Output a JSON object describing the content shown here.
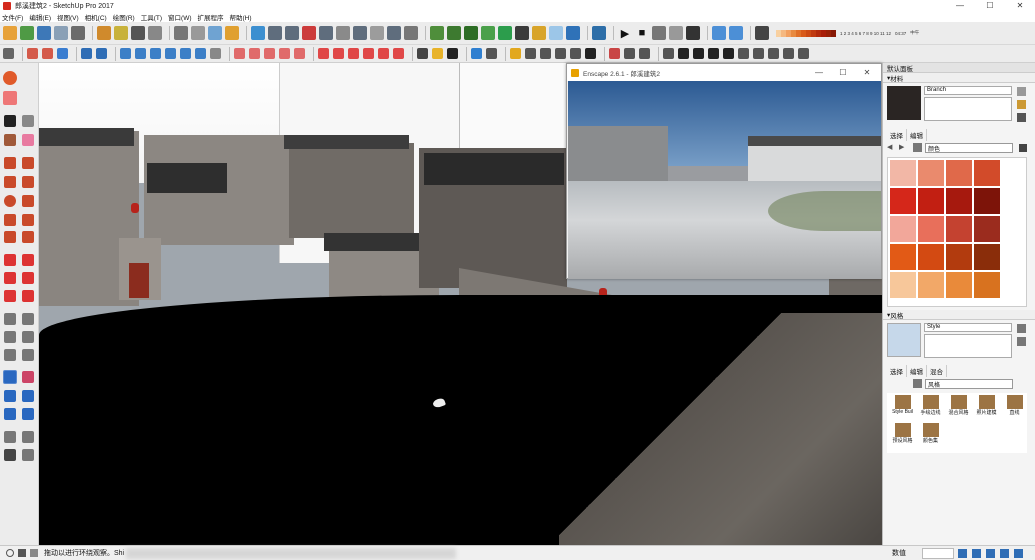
{
  "window": {
    "title": "郎溪建筑2 - SketchUp Pro 2017",
    "min": "—",
    "max": "☐",
    "close": "✕"
  },
  "menu": [
    "文件(F)",
    "编辑(E)",
    "视图(V)",
    "相机(C)",
    "绘图(R)",
    "工具(T)",
    "窗口(W)",
    "扩展程序",
    "帮助(H)"
  ],
  "toolbar": {
    "palette_numbers": "1 2 3 4 5 6 7 8 9 10 11 12",
    "time": "04:37",
    "time_label": "中午"
  },
  "enscape": {
    "title": "Enscape 2.6.1 - 郎溪建筑2",
    "min": "—",
    "max": "☐",
    "close": "✕"
  },
  "default_panel": {
    "title": "默认面板",
    "materials": {
      "section": "材料",
      "name": "Branch",
      "tabs": [
        "选择",
        "编辑"
      ],
      "library": "颜色",
      "swatches": [
        "#f2b7a6",
        "#ea8a6d",
        "#e0694a",
        "#d24b2a",
        "#d5271a",
        "#c21f12",
        "#a6190e",
        "#7d1409",
        "#f2a79a",
        "#e86f5b",
        "#c44230",
        "#9b2c1e",
        "#e25a16",
        "#d34a12",
        "#b23b0e",
        "#8a2d0a",
        "#f7c79a",
        "#f2a868",
        "#e98a3a",
        "#d8721f"
      ]
    },
    "styles": {
      "section": "风格",
      "name": "Style",
      "tabs": [
        "选择",
        "编辑",
        "混合"
      ],
      "library": "风格",
      "items": [
        "Style Buil",
        "手绘边线",
        "混合风格",
        "照片建模",
        "直线",
        "预设风格",
        "颜色集"
      ]
    }
  },
  "status": {
    "hint": "拖动以进行环绕观察。Shi",
    "measurements_label": "数值"
  }
}
